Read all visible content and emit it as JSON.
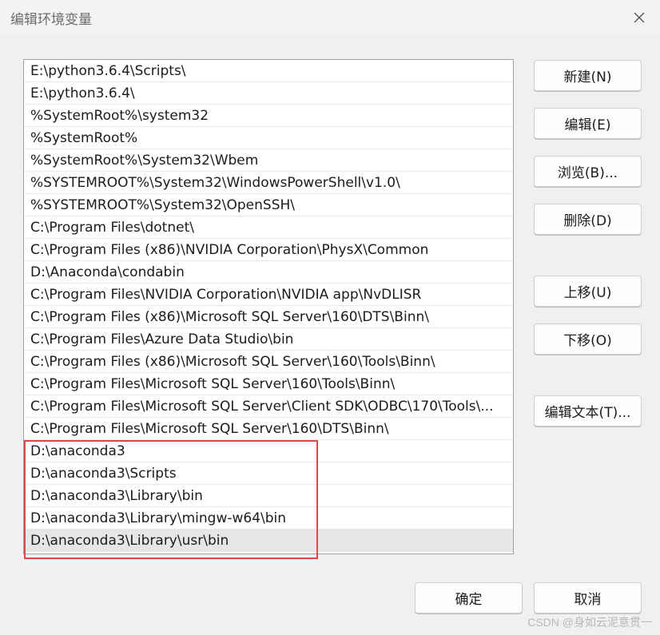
{
  "window": {
    "title": "编辑环境变量",
    "close_symbol": "✕"
  },
  "path_list": {
    "items": [
      "E:\\python3.6.4\\Scripts\\",
      "E:\\python3.6.4\\",
      "%SystemRoot%\\system32",
      "%SystemRoot%",
      "%SystemRoot%\\System32\\Wbem",
      "%SYSTEMROOT%\\System32\\WindowsPowerShell\\v1.0\\",
      "%SYSTEMROOT%\\System32\\OpenSSH\\",
      "C:\\Program Files\\dotnet\\",
      "C:\\Program Files (x86)\\NVIDIA Corporation\\PhysX\\Common",
      "D:\\Anaconda\\condabin",
      "C:\\Program Files\\NVIDIA Corporation\\NVIDIA app\\NvDLISR",
      "C:\\Program Files (x86)\\Microsoft SQL Server\\160\\DTS\\Binn\\",
      "C:\\Program Files\\Azure Data Studio\\bin",
      "C:\\Program Files (x86)\\Microsoft SQL Server\\160\\Tools\\Binn\\",
      "C:\\Program Files\\Microsoft SQL Server\\160\\Tools\\Binn\\",
      "C:\\Program Files\\Microsoft SQL Server\\Client SDK\\ODBC\\170\\Tools\\...",
      "C:\\Program Files\\Microsoft SQL Server\\160\\DTS\\Binn\\",
      "D:\\anaconda3",
      "D:\\anaconda3\\Scripts",
      "D:\\anaconda3\\Library\\bin",
      "D:\\anaconda3\\Library\\mingw-w64\\bin",
      "D:\\anaconda3\\Library\\usr\\bin"
    ],
    "selected_index": 21
  },
  "buttons": {
    "new": "新建(N)",
    "edit": "编辑(E)",
    "browse": "浏览(B)...",
    "delete": "删除(D)",
    "move_up": "上移(U)",
    "move_down": "下移(O)",
    "edit_text": "编辑文本(T)...",
    "ok": "确定",
    "cancel": "取消"
  },
  "watermark": "CSDN @身如云泥意贯一",
  "colors": {
    "highlight_box": "#e04848",
    "selected_row": "#e6e6e6"
  }
}
